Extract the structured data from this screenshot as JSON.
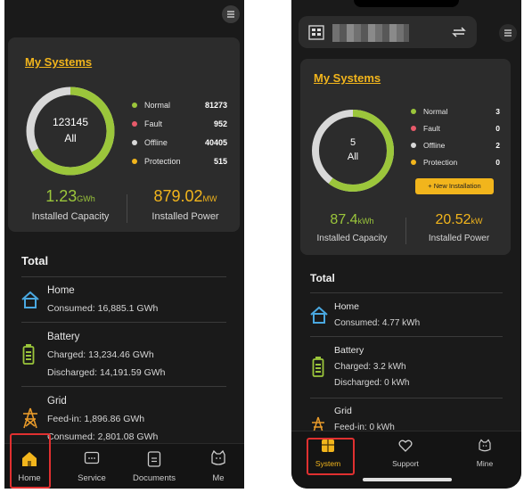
{
  "home_screen": {
    "title": "My Systems",
    "donut": {
      "total": "123145",
      "total_label": "All",
      "online_fraction": 0.67,
      "offline_fraction": 0.33
    },
    "legend": [
      {
        "label": "Normal",
        "value": "81273",
        "color": "#9bc63b"
      },
      {
        "label": "Fault",
        "value": "952",
        "color": "#e85a6a"
      },
      {
        "label": "Offline",
        "value": "40405",
        "color": "#d8d8d8"
      },
      {
        "label": "Protection",
        "value": "515",
        "color": "#f2b51c"
      }
    ],
    "capacity": {
      "value": "1.23",
      "unit": "GWh",
      "label": "Installed Capacity"
    },
    "power": {
      "value": "879.02",
      "unit": "MW",
      "label": "Installed Power"
    },
    "total_title": "Total",
    "home": {
      "title": "Home",
      "consumed": "Consumed: 16,885.1 GWh"
    },
    "battery": {
      "title": "Battery",
      "charged": "Charged: 13,234.46 GWh",
      "discharged": "Discharged: 14,191.59 GWh"
    },
    "grid": {
      "title": "Grid",
      "feedin": "Feed-in: 1,896.86 GWh",
      "consumed": "Consumed: 2,801.08 GWh"
    },
    "tabs": [
      {
        "label": "Home",
        "icon": "home-icon"
      },
      {
        "label": "Service",
        "icon": "chat-icon"
      },
      {
        "label": "Documents",
        "icon": "document-icon"
      },
      {
        "label": "Me",
        "icon": "cat-face-icon"
      }
    ]
  },
  "system_screen": {
    "title": "My Systems",
    "donut": {
      "total": "5",
      "total_label": "All",
      "online_fraction": 0.6,
      "offline_fraction": 0.4
    },
    "legend": [
      {
        "label": "Normal",
        "value": "3",
        "color": "#9bc63b"
      },
      {
        "label": "Fault",
        "value": "0",
        "color": "#e85a6a"
      },
      {
        "label": "Offline",
        "value": "2",
        "color": "#d8d8d8"
      },
      {
        "label": "Protection",
        "value": "0",
        "color": "#f2b51c"
      }
    ],
    "new_installation": "+ New Installation",
    "capacity": {
      "value": "87.4",
      "unit": "kWh",
      "label": "Installed Capacity"
    },
    "power": {
      "value": "20.52",
      "unit": "kW",
      "label": "Installed Power"
    },
    "total_title": "Total",
    "home": {
      "title": "Home",
      "consumed": "Consumed: 4.77 kWh"
    },
    "battery": {
      "title": "Battery",
      "charged": "Charged: 3.2 kWh",
      "discharged": "Discharged: 0 kWh"
    },
    "grid": {
      "title": "Grid",
      "feedin": "Feed-in: 0 kWh"
    },
    "tabs": [
      {
        "label": "System",
        "icon": "system-icon"
      },
      {
        "label": "Support",
        "icon": "support-icon"
      },
      {
        "label": "Mine",
        "icon": "cat-face-icon"
      }
    ]
  },
  "colors": {
    "accent": "#f2b51c",
    "online": "#9bc63b",
    "offline": "#d8d8d8",
    "highlight": "#e03030"
  }
}
